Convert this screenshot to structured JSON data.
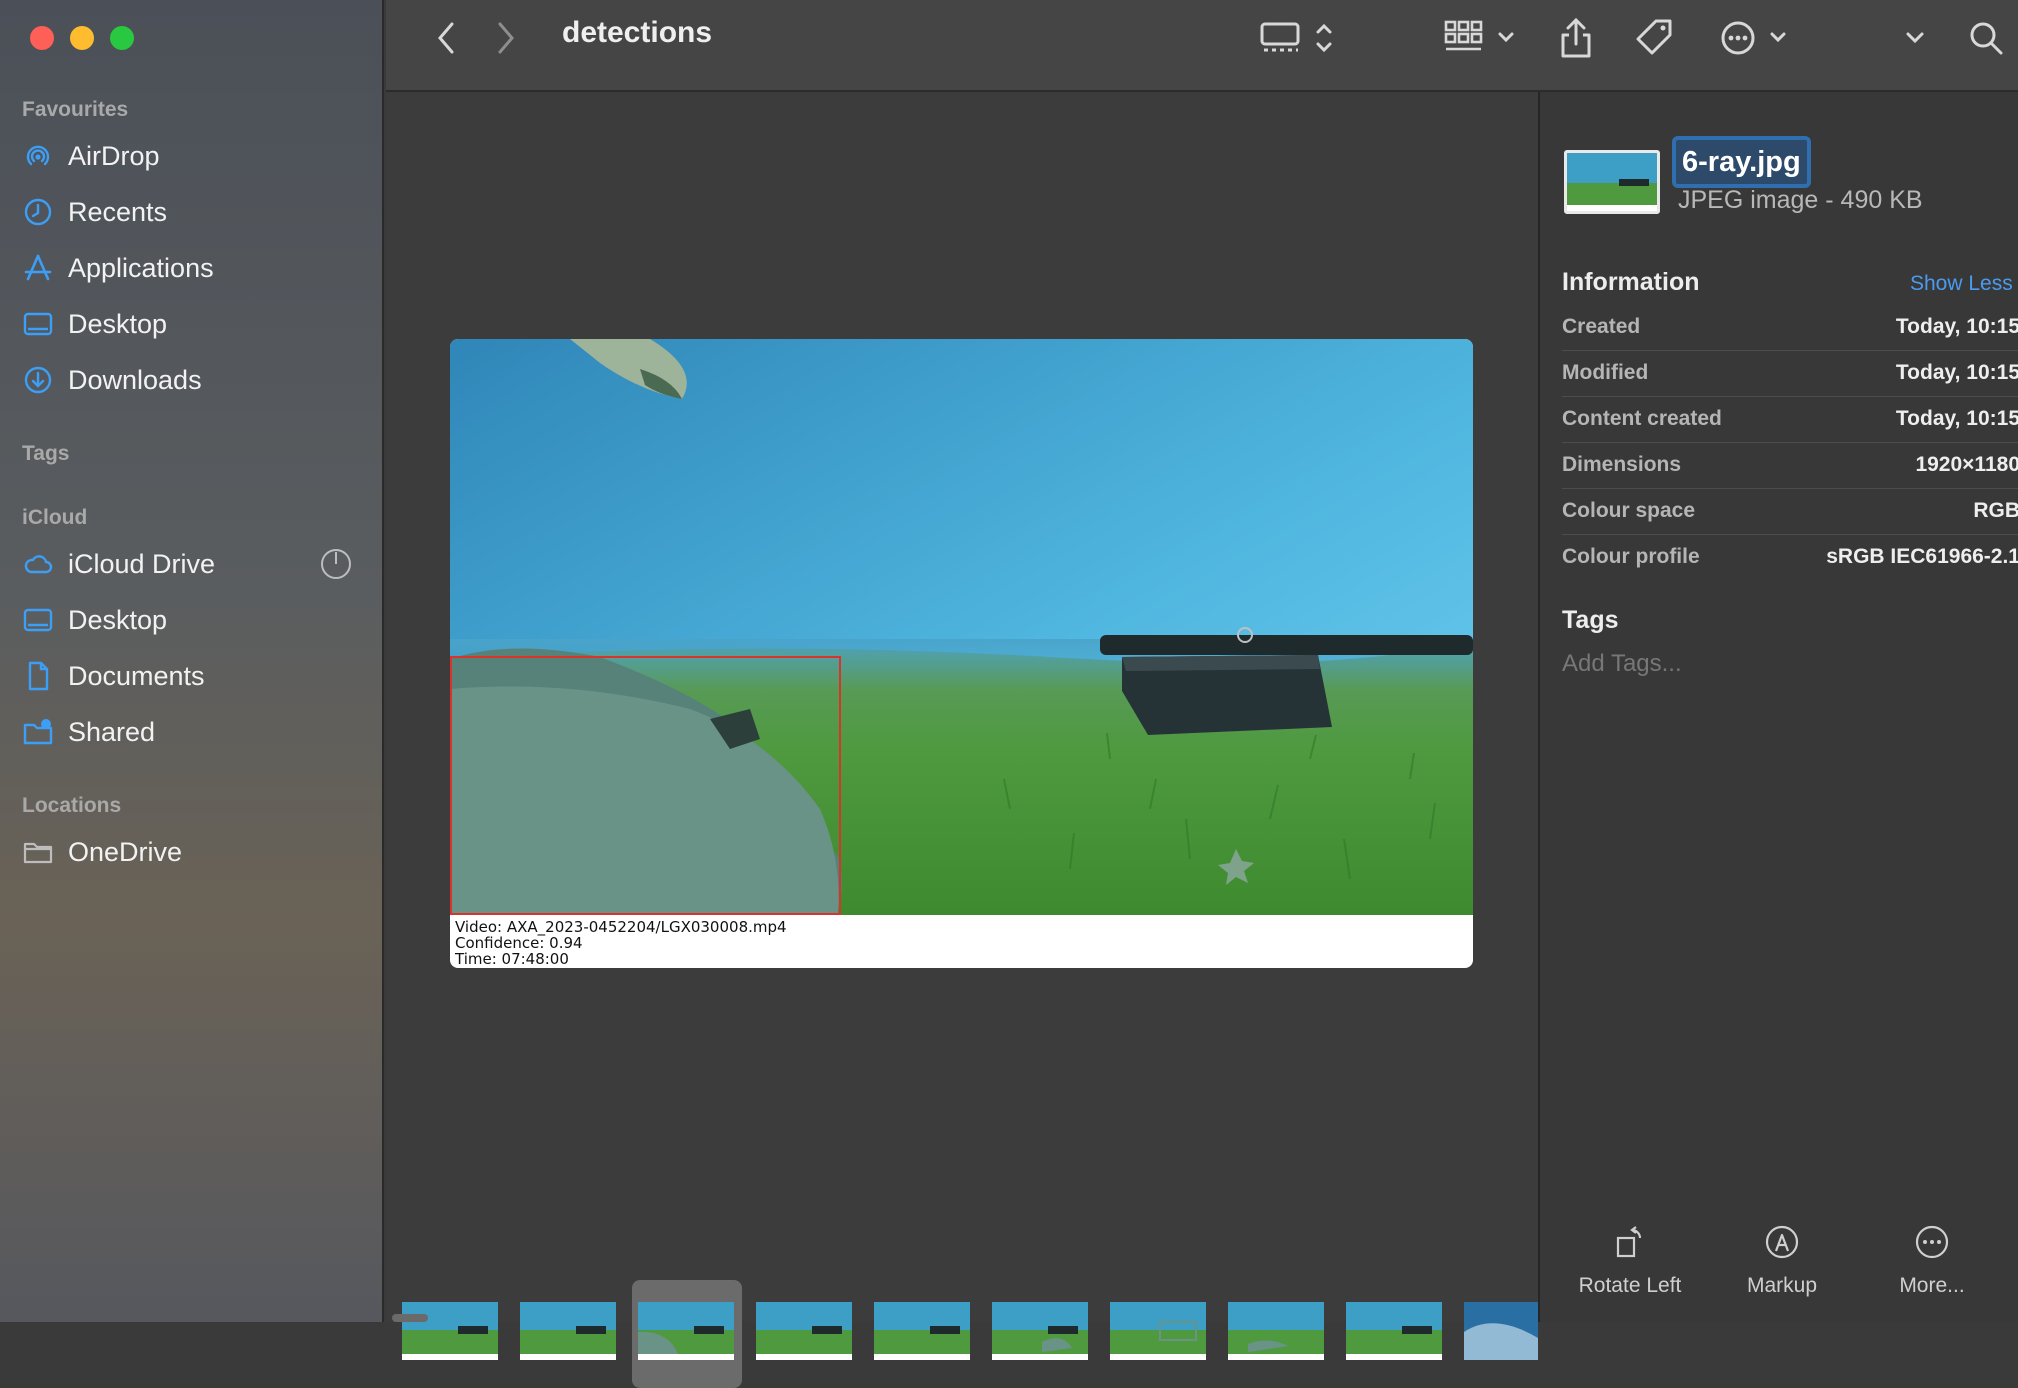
{
  "window": {
    "folder_title": "detections"
  },
  "sidebar": {
    "favourites_title": "Favourites",
    "favourites": [
      {
        "label": "AirDrop",
        "icon": "airdrop-icon"
      },
      {
        "label": "Recents",
        "icon": "clock-icon"
      },
      {
        "label": "Applications",
        "icon": "applications-icon"
      },
      {
        "label": "Desktop",
        "icon": "desktop-icon"
      },
      {
        "label": "Downloads",
        "icon": "download-icon"
      }
    ],
    "tags_title": "Tags",
    "icloud_title": "iCloud",
    "icloud": [
      {
        "label": "iCloud Drive",
        "icon": "cloud-icon"
      },
      {
        "label": "Desktop",
        "icon": "desktop-icon"
      },
      {
        "label": "Documents",
        "icon": "document-icon"
      },
      {
        "label": "Shared",
        "icon": "shared-folder-icon"
      }
    ],
    "locations_title": "Locations",
    "locations": [
      {
        "label": "OneDrive",
        "icon": "folder-icon"
      }
    ]
  },
  "preview": {
    "caption_lines": [
      "Video: AXA_2023-0452204/LGX030008.mp4",
      "Confidence: 0.94",
      "Time: 07:48:00"
    ]
  },
  "info": {
    "file_name": "6-ray.jpg",
    "file_type": "JPEG image - 490 KB",
    "section_title": "Information",
    "show_less": "Show Less",
    "rows": [
      {
        "key": "Created",
        "value": "Today, 10:15"
      },
      {
        "key": "Modified",
        "value": "Today, 10:15"
      },
      {
        "key": "Content created",
        "value": "Today, 10:15"
      },
      {
        "key": "Dimensions",
        "value": "1920×1180"
      },
      {
        "key": "Colour space",
        "value": "RGB"
      },
      {
        "key": "Colour profile",
        "value": "sRGB IEC61966-2.1"
      }
    ],
    "tags_title": "Tags",
    "add_tags": "Add Tags...",
    "actions": [
      {
        "label": "Rotate Left",
        "icon": "rotate-left-icon"
      },
      {
        "label": "Markup",
        "icon": "markup-icon"
      },
      {
        "label": "More...",
        "icon": "more-icon"
      }
    ]
  },
  "colors": {
    "accent": "#4a9bf0",
    "selection": "#2f6fb0",
    "sidebar_icon": "#3d9ef5"
  }
}
